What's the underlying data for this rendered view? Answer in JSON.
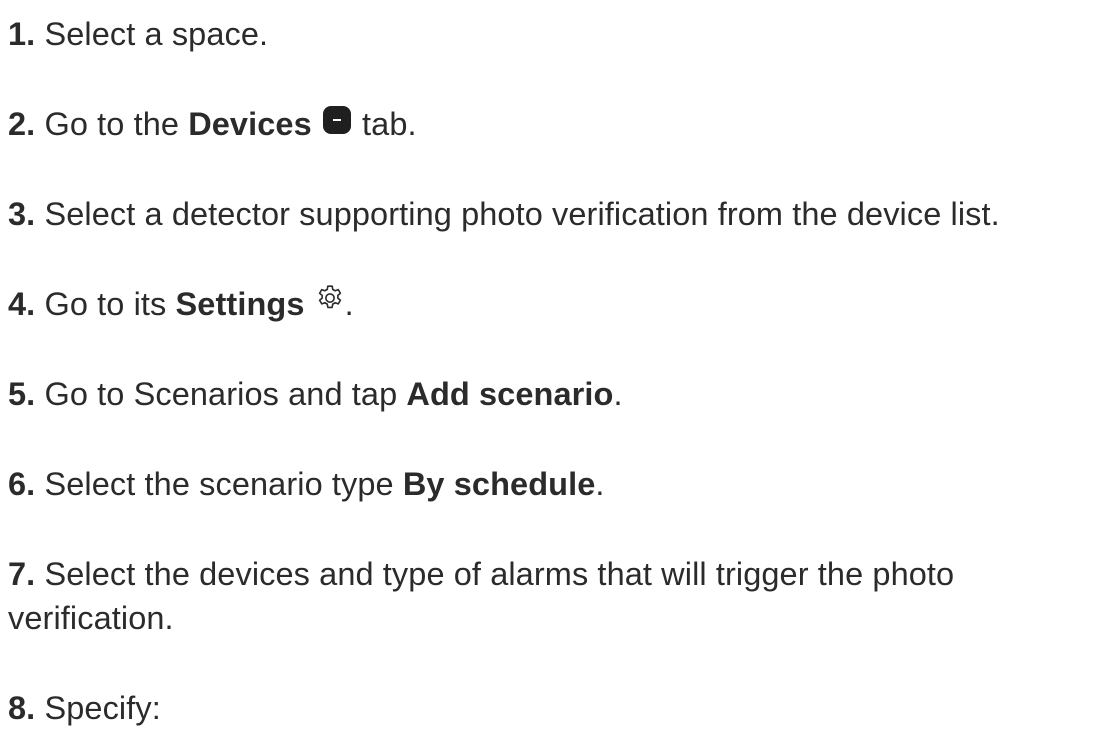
{
  "steps": [
    {
      "num": "1.",
      "pre": "Select a space."
    },
    {
      "num": "2.",
      "pre": "Go to the ",
      "bold": "Devices",
      "icon": "devices-tab-icon",
      "post": " tab."
    },
    {
      "num": "3.",
      "pre": "Select a detector supporting photo verification from the device list."
    },
    {
      "num": "4.",
      "pre": "Go to its ",
      "bold": "Settings",
      "icon": "gear-icon",
      "post": "."
    },
    {
      "num": "5.",
      "pre": "Go to Scenarios and tap ",
      "bold": "Add scenario",
      "post": "."
    },
    {
      "num": "6.",
      "pre": "Select the scenario type ",
      "bold": "By schedule",
      "post": "."
    },
    {
      "num": "7.",
      "pre": "Select the devices and type of alarms that will trigger the photo verification."
    },
    {
      "num": "8.",
      "pre": "Specify:"
    }
  ]
}
